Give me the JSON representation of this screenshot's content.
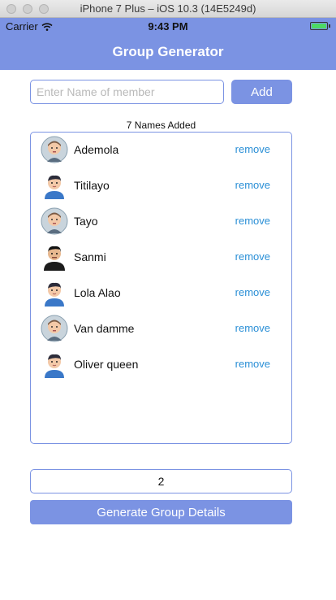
{
  "window": {
    "title": "iPhone 7 Plus – iOS 10.3 (14E5249d)"
  },
  "status_bar": {
    "carrier": "Carrier",
    "time": "9:43 PM",
    "battery_color": "#4cd964"
  },
  "nav": {
    "title": "Group Generator",
    "color": "#7b93e3"
  },
  "form": {
    "name_placeholder": "Enter Name of member",
    "name_value": "",
    "add_label": "Add"
  },
  "list": {
    "count_label": "7 Names Added",
    "remove_label": "remove",
    "members": [
      {
        "name": "Ademola",
        "avatar": "avatar-round-grey-icon"
      },
      {
        "name": "Titilayo",
        "avatar": "avatar-blue-shirt-icon"
      },
      {
        "name": "Tayo",
        "avatar": "avatar-round-grey-icon"
      },
      {
        "name": "Sanmi",
        "avatar": "avatar-dark-icon"
      },
      {
        "name": "Lola Alao",
        "avatar": "avatar-blue-shirt-icon"
      },
      {
        "name": "Van damme",
        "avatar": "avatar-round-grey-icon"
      },
      {
        "name": "Oliver queen",
        "avatar": "avatar-blue-shirt-icon"
      }
    ]
  },
  "group": {
    "size_value": "2",
    "generate_label": "Generate Group Details"
  }
}
